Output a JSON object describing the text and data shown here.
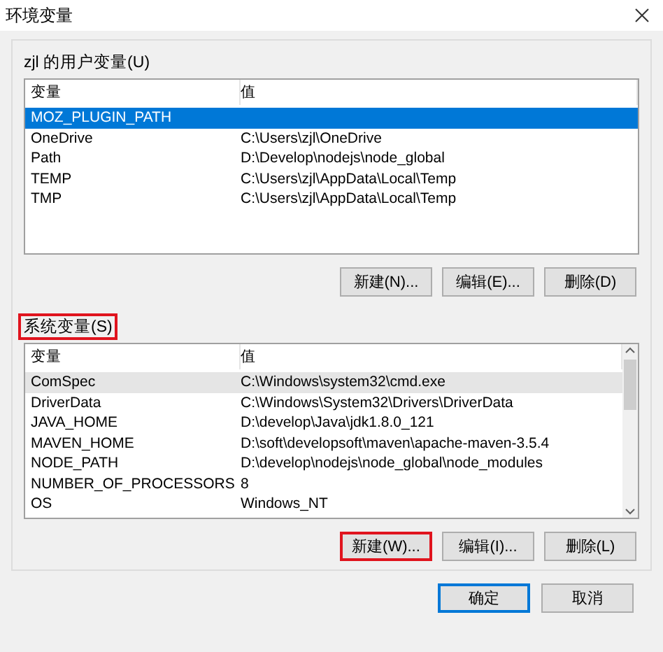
{
  "window": {
    "title": "环境变量"
  },
  "user_variables": {
    "label": "zjl 的用户变量(U)",
    "highlighted": false,
    "columns": [
      "变量",
      "值"
    ],
    "rows": [
      {
        "name": "MOZ_PLUGIN_PATH",
        "value": "",
        "selected": true
      },
      {
        "name": "OneDrive",
        "value": "C:\\Users\\zjl\\OneDrive",
        "selected": false
      },
      {
        "name": "Path",
        "value": "D:\\Develop\\nodejs\\node_global",
        "selected": false
      },
      {
        "name": "TEMP",
        "value": "C:\\Users\\zjl\\AppData\\Local\\Temp",
        "selected": false
      },
      {
        "name": "TMP",
        "value": "C:\\Users\\zjl\\AppData\\Local\\Temp",
        "selected": false
      }
    ],
    "buttons": [
      {
        "label": "新建(N)...",
        "highlighted": false
      },
      {
        "label": "编辑(E)...",
        "highlighted": false
      },
      {
        "label": "删除(D)",
        "highlighted": false
      }
    ]
  },
  "system_variables": {
    "label": "系统变量(S)",
    "highlighted": true,
    "columns": [
      "变量",
      "值"
    ],
    "rows": [
      {
        "name": "ComSpec",
        "value": "C:\\Windows\\system32\\cmd.exe",
        "selected": true
      },
      {
        "name": "DriverData",
        "value": "C:\\Windows\\System32\\Drivers\\DriverData",
        "selected": false
      },
      {
        "name": "JAVA_HOME",
        "value": "D:\\develop\\Java\\jdk1.8.0_121",
        "selected": false
      },
      {
        "name": "MAVEN_HOME",
        "value": "D:\\soft\\developsoft\\maven\\apache-maven-3.5.4",
        "selected": false
      },
      {
        "name": "NODE_PATH",
        "value": "D:\\develop\\nodejs\\node_global\\node_modules",
        "selected": false
      },
      {
        "name": "NUMBER_OF_PROCESSORS",
        "value": "8",
        "selected": false
      },
      {
        "name": "OS",
        "value": "Windows_NT",
        "selected": false
      }
    ],
    "buttons": [
      {
        "label": "新建(W)...",
        "highlighted": true
      },
      {
        "label": "编辑(I)...",
        "highlighted": false
      },
      {
        "label": "删除(L)",
        "highlighted": false
      }
    ]
  },
  "footer_buttons": [
    {
      "label": "确定",
      "default": true
    },
    {
      "label": "取消",
      "default": false
    }
  ]
}
